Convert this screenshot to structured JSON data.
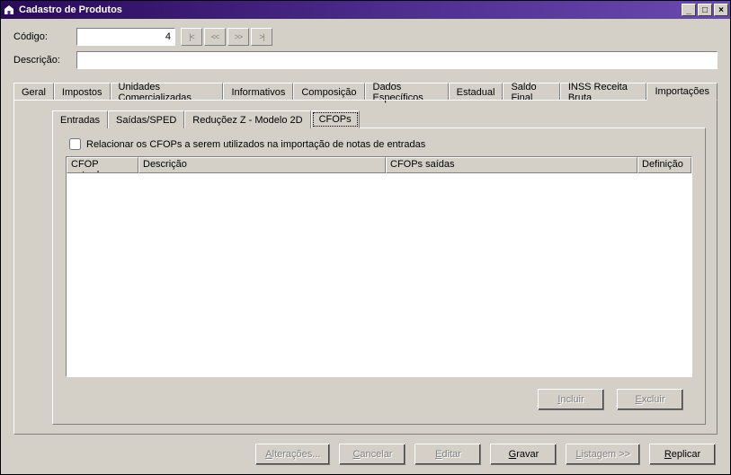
{
  "window": {
    "title": "Cadastro de Produtos"
  },
  "fields": {
    "codigo_label": "Código:",
    "codigo_value": "4",
    "descricao_label": "Descrição:",
    "descricao_value": ""
  },
  "nav": {
    "first": "|<",
    "prev": "<<",
    "next": ">>",
    "last": ">|"
  },
  "tabs": {
    "geral": "Geral",
    "impostos": "Impostos",
    "unidades": "Unidades Comercializadas",
    "informativos": "Informativos",
    "composicao": "Composição",
    "dados": "Dados Específicos",
    "estadual": "Estadual",
    "saldofinal": "Saldo Final",
    "inss": "INSS Receita Bruta",
    "importacoes": "Importações"
  },
  "innerTabs": {
    "entradas": "Entradas",
    "saidas": "Saídas/SPED",
    "reducoes": "Reduçõez Z - Modelo 2D",
    "cfops": "CFOPs"
  },
  "checkbox": {
    "label": "Relacionar os CFOPs a serem utilizados na importação de notas de entradas"
  },
  "gridCols": {
    "cfop_entrada": "CFOP entrada",
    "descricao": "Descrição",
    "cfops_saidas": "CFOPs saídas",
    "definicao": "Definição"
  },
  "innerButtons": {
    "incluir": "Incluir",
    "excluir": "Excluir"
  },
  "footerButtons": {
    "alteracoes": "Alterações...",
    "cancelar": "Cancelar",
    "editar": "Editar",
    "gravar": "Gravar",
    "listagem": "Listagem >>",
    "replicar": "Replicar"
  }
}
